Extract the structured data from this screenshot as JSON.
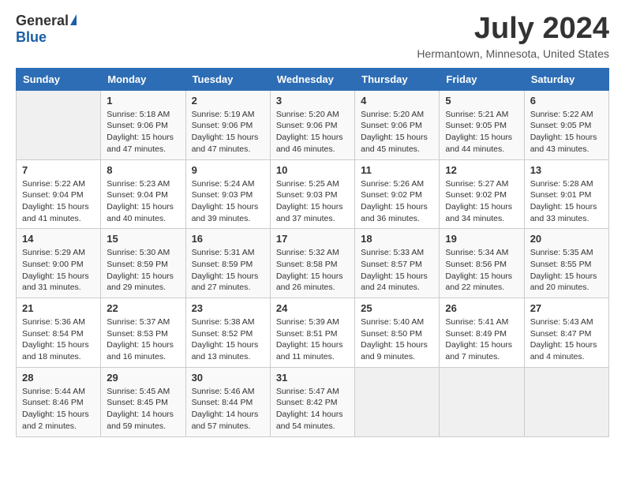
{
  "header": {
    "logo_general": "General",
    "logo_blue": "Blue",
    "month_title": "July 2024",
    "location": "Hermantown, Minnesota, United States"
  },
  "days_of_week": [
    "Sunday",
    "Monday",
    "Tuesday",
    "Wednesday",
    "Thursday",
    "Friday",
    "Saturday"
  ],
  "weeks": [
    [
      {
        "date": "",
        "lines": []
      },
      {
        "date": "1",
        "lines": [
          "Sunrise: 5:18 AM",
          "Sunset: 9:06 PM",
          "Daylight: 15 hours",
          "and 47 minutes."
        ]
      },
      {
        "date": "2",
        "lines": [
          "Sunrise: 5:19 AM",
          "Sunset: 9:06 PM",
          "Daylight: 15 hours",
          "and 47 minutes."
        ]
      },
      {
        "date": "3",
        "lines": [
          "Sunrise: 5:20 AM",
          "Sunset: 9:06 PM",
          "Daylight: 15 hours",
          "and 46 minutes."
        ]
      },
      {
        "date": "4",
        "lines": [
          "Sunrise: 5:20 AM",
          "Sunset: 9:06 PM",
          "Daylight: 15 hours",
          "and 45 minutes."
        ]
      },
      {
        "date": "5",
        "lines": [
          "Sunrise: 5:21 AM",
          "Sunset: 9:05 PM",
          "Daylight: 15 hours",
          "and 44 minutes."
        ]
      },
      {
        "date": "6",
        "lines": [
          "Sunrise: 5:22 AM",
          "Sunset: 9:05 PM",
          "Daylight: 15 hours",
          "and 43 minutes."
        ]
      }
    ],
    [
      {
        "date": "7",
        "lines": [
          "Sunrise: 5:22 AM",
          "Sunset: 9:04 PM",
          "Daylight: 15 hours",
          "and 41 minutes."
        ]
      },
      {
        "date": "8",
        "lines": [
          "Sunrise: 5:23 AM",
          "Sunset: 9:04 PM",
          "Daylight: 15 hours",
          "and 40 minutes."
        ]
      },
      {
        "date": "9",
        "lines": [
          "Sunrise: 5:24 AM",
          "Sunset: 9:03 PM",
          "Daylight: 15 hours",
          "and 39 minutes."
        ]
      },
      {
        "date": "10",
        "lines": [
          "Sunrise: 5:25 AM",
          "Sunset: 9:03 PM",
          "Daylight: 15 hours",
          "and 37 minutes."
        ]
      },
      {
        "date": "11",
        "lines": [
          "Sunrise: 5:26 AM",
          "Sunset: 9:02 PM",
          "Daylight: 15 hours",
          "and 36 minutes."
        ]
      },
      {
        "date": "12",
        "lines": [
          "Sunrise: 5:27 AM",
          "Sunset: 9:02 PM",
          "Daylight: 15 hours",
          "and 34 minutes."
        ]
      },
      {
        "date": "13",
        "lines": [
          "Sunrise: 5:28 AM",
          "Sunset: 9:01 PM",
          "Daylight: 15 hours",
          "and 33 minutes."
        ]
      }
    ],
    [
      {
        "date": "14",
        "lines": [
          "Sunrise: 5:29 AM",
          "Sunset: 9:00 PM",
          "Daylight: 15 hours",
          "and 31 minutes."
        ]
      },
      {
        "date": "15",
        "lines": [
          "Sunrise: 5:30 AM",
          "Sunset: 8:59 PM",
          "Daylight: 15 hours",
          "and 29 minutes."
        ]
      },
      {
        "date": "16",
        "lines": [
          "Sunrise: 5:31 AM",
          "Sunset: 8:59 PM",
          "Daylight: 15 hours",
          "and 27 minutes."
        ]
      },
      {
        "date": "17",
        "lines": [
          "Sunrise: 5:32 AM",
          "Sunset: 8:58 PM",
          "Daylight: 15 hours",
          "and 26 minutes."
        ]
      },
      {
        "date": "18",
        "lines": [
          "Sunrise: 5:33 AM",
          "Sunset: 8:57 PM",
          "Daylight: 15 hours",
          "and 24 minutes."
        ]
      },
      {
        "date": "19",
        "lines": [
          "Sunrise: 5:34 AM",
          "Sunset: 8:56 PM",
          "Daylight: 15 hours",
          "and 22 minutes."
        ]
      },
      {
        "date": "20",
        "lines": [
          "Sunrise: 5:35 AM",
          "Sunset: 8:55 PM",
          "Daylight: 15 hours",
          "and 20 minutes."
        ]
      }
    ],
    [
      {
        "date": "21",
        "lines": [
          "Sunrise: 5:36 AM",
          "Sunset: 8:54 PM",
          "Daylight: 15 hours",
          "and 18 minutes."
        ]
      },
      {
        "date": "22",
        "lines": [
          "Sunrise: 5:37 AM",
          "Sunset: 8:53 PM",
          "Daylight: 15 hours",
          "and 16 minutes."
        ]
      },
      {
        "date": "23",
        "lines": [
          "Sunrise: 5:38 AM",
          "Sunset: 8:52 PM",
          "Daylight: 15 hours",
          "and 13 minutes."
        ]
      },
      {
        "date": "24",
        "lines": [
          "Sunrise: 5:39 AM",
          "Sunset: 8:51 PM",
          "Daylight: 15 hours",
          "and 11 minutes."
        ]
      },
      {
        "date": "25",
        "lines": [
          "Sunrise: 5:40 AM",
          "Sunset: 8:50 PM",
          "Daylight: 15 hours",
          "and 9 minutes."
        ]
      },
      {
        "date": "26",
        "lines": [
          "Sunrise: 5:41 AM",
          "Sunset: 8:49 PM",
          "Daylight: 15 hours",
          "and 7 minutes."
        ]
      },
      {
        "date": "27",
        "lines": [
          "Sunrise: 5:43 AM",
          "Sunset: 8:47 PM",
          "Daylight: 15 hours",
          "and 4 minutes."
        ]
      }
    ],
    [
      {
        "date": "28",
        "lines": [
          "Sunrise: 5:44 AM",
          "Sunset: 8:46 PM",
          "Daylight: 15 hours",
          "and 2 minutes."
        ]
      },
      {
        "date": "29",
        "lines": [
          "Sunrise: 5:45 AM",
          "Sunset: 8:45 PM",
          "Daylight: 14 hours",
          "and 59 minutes."
        ]
      },
      {
        "date": "30",
        "lines": [
          "Sunrise: 5:46 AM",
          "Sunset: 8:44 PM",
          "Daylight: 14 hours",
          "and 57 minutes."
        ]
      },
      {
        "date": "31",
        "lines": [
          "Sunrise: 5:47 AM",
          "Sunset: 8:42 PM",
          "Daylight: 14 hours",
          "and 54 minutes."
        ]
      },
      {
        "date": "",
        "lines": []
      },
      {
        "date": "",
        "lines": []
      },
      {
        "date": "",
        "lines": []
      }
    ]
  ]
}
